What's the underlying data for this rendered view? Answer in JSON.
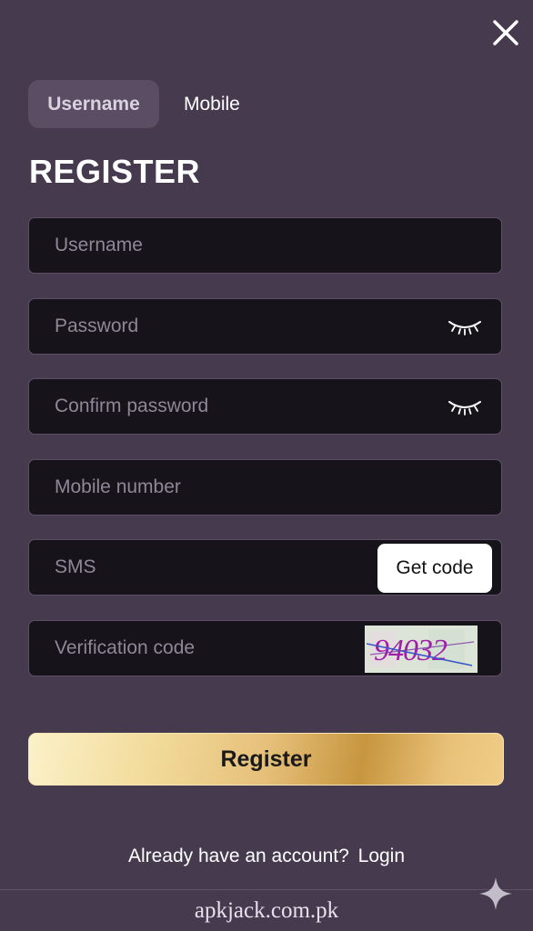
{
  "tabs": [
    {
      "label": "Username",
      "active": true
    },
    {
      "label": "Mobile",
      "active": false
    }
  ],
  "title": "REGISTER",
  "fields": {
    "username": {
      "placeholder": "Username",
      "value": ""
    },
    "password": {
      "placeholder": "Password",
      "value": ""
    },
    "confirm_password": {
      "placeholder": "Confirm password",
      "value": ""
    },
    "mobile": {
      "placeholder": "Mobile number",
      "value": ""
    },
    "sms": {
      "placeholder": "SMS",
      "value": ""
    },
    "verification": {
      "placeholder": "Verification code",
      "value": ""
    }
  },
  "get_code_label": "Get code",
  "captcha_text": "94032",
  "register_label": "Register",
  "login_prompt": "Already have an account?",
  "login_link": "Login",
  "watermark": "apkjack.com.pk",
  "icons": {
    "close": "close-icon",
    "eye": "eye-closed-icon",
    "sparkle": "sparkle-icon"
  },
  "colors": {
    "background": "#463a4f",
    "field_bg": "#17131b",
    "accent_gold": "#d9ac5b"
  }
}
